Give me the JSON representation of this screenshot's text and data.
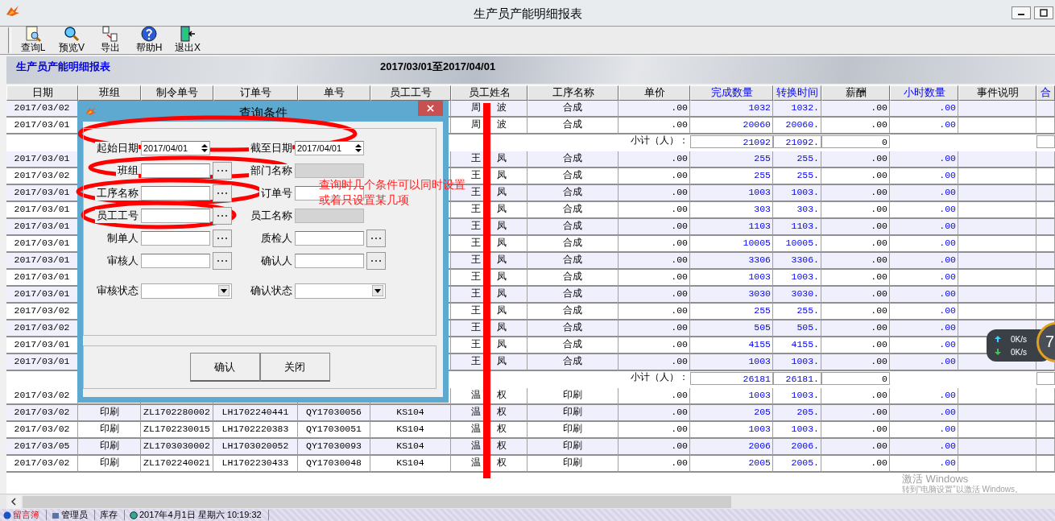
{
  "window": {
    "title": "生产员产能明细报表"
  },
  "toolbar": [
    {
      "label": "查询L",
      "kind": "query"
    },
    {
      "label": "预览V",
      "kind": "preview"
    },
    {
      "label": "导出",
      "kind": "export"
    },
    {
      "label": "帮助H",
      "kind": "help"
    },
    {
      "label": "退出X",
      "kind": "exit"
    }
  ],
  "report_header": {
    "title": "生产员产能明细报表",
    "date_range": "2017/03/01至2017/04/01"
  },
  "table": {
    "columns": [
      "日期",
      "班组",
      "制令单号",
      "订单号",
      "单号",
      "员工工号",
      "员工姓名",
      "工序名称",
      "单价",
      "完成数量",
      "转换时间",
      "薪酬",
      "小时数量",
      "事件说明",
      "合"
    ],
    "rows": [
      {
        "kind": "data",
        "date": "2017/03/02",
        "employee_name": "周 波",
        "process": "合成",
        "unit_price": ".00",
        "completed_qty": "1032",
        "converted_time": "1032.",
        "pay": ".00",
        "hours": ".00"
      },
      {
        "kind": "data",
        "date": "2017/03/01",
        "employee_name": "周 波",
        "process": "合成",
        "unit_price": ".00",
        "completed_qty": "20060",
        "converted_time": "20060.",
        "pay": ".00",
        "hours": ".00"
      },
      {
        "kind": "subtotal",
        "unit_price": "小计（人）：",
        "completed_qty": "21092",
        "converted_time": "21092.",
        "pay": "0"
      },
      {
        "kind": "data",
        "date": "2017/03/01",
        "employee_name": "王 凤",
        "process": "合成",
        "unit_price": ".00",
        "completed_qty": "255",
        "converted_time": "255.",
        "pay": ".00",
        "hours": ".00"
      },
      {
        "kind": "data",
        "date": "2017/03/02",
        "employee_name": "王 凤",
        "process": "合成",
        "unit_price": ".00",
        "completed_qty": "255",
        "converted_time": "255.",
        "pay": ".00",
        "hours": ".00"
      },
      {
        "kind": "data",
        "date": "2017/03/01",
        "employee_name": "王 凤",
        "process": "合成",
        "unit_price": ".00",
        "completed_qty": "1003",
        "converted_time": "1003.",
        "pay": ".00",
        "hours": ".00"
      },
      {
        "kind": "data",
        "date": "2017/03/01",
        "employee_name": "王 凤",
        "process": "合成",
        "unit_price": ".00",
        "completed_qty": "303",
        "converted_time": "303.",
        "pay": ".00",
        "hours": ".00"
      },
      {
        "kind": "data",
        "date": "2017/03/01",
        "employee_name": "王 凤",
        "process": "合成",
        "unit_price": ".00",
        "completed_qty": "1103",
        "converted_time": "1103.",
        "pay": ".00",
        "hours": ".00"
      },
      {
        "kind": "data",
        "date": "2017/03/01",
        "employee_name": "王 凤",
        "process": "合成",
        "unit_price": ".00",
        "completed_qty": "10005",
        "converted_time": "10005.",
        "pay": ".00",
        "hours": ".00"
      },
      {
        "kind": "data",
        "date": "2017/03/01",
        "employee_name": "王 凤",
        "process": "合成",
        "unit_price": ".00",
        "completed_qty": "3306",
        "converted_time": "3306.",
        "pay": ".00",
        "hours": ".00"
      },
      {
        "kind": "data",
        "date": "2017/03/01",
        "employee_name": "王 凤",
        "process": "合成",
        "unit_price": ".00",
        "completed_qty": "1003",
        "converted_time": "1003.",
        "pay": ".00",
        "hours": ".00"
      },
      {
        "kind": "data",
        "date": "2017/03/01",
        "employee_name": "王 凤",
        "process": "合成",
        "unit_price": ".00",
        "completed_qty": "3030",
        "converted_time": "3030.",
        "pay": ".00",
        "hours": ".00"
      },
      {
        "kind": "data",
        "date": "2017/03/02",
        "employee_name": "王 凤",
        "process": "合成",
        "unit_price": ".00",
        "completed_qty": "255",
        "converted_time": "255.",
        "pay": ".00",
        "hours": ".00"
      },
      {
        "kind": "data",
        "date": "2017/03/02",
        "employee_name": "王 凤",
        "process": "合成",
        "unit_price": ".00",
        "completed_qty": "505",
        "converted_time": "505.",
        "pay": ".00",
        "hours": ".00"
      },
      {
        "kind": "data",
        "date": "2017/03/01",
        "employee_name": "王 凤",
        "process": "合成",
        "unit_price": ".00",
        "completed_qty": "4155",
        "converted_time": "4155.",
        "pay": ".00",
        "hours": ".00"
      },
      {
        "kind": "data",
        "date": "2017/03/01",
        "employee_name": "王 凤",
        "process": "合成",
        "unit_price": ".00",
        "completed_qty": "1003",
        "converted_time": "1003.",
        "pay": ".00",
        "hours": ".00"
      },
      {
        "kind": "subtotal",
        "unit_price": "小计（人）：",
        "completed_qty": "26181",
        "converted_time": "26181.",
        "pay": "0"
      },
      {
        "kind": "data",
        "date": "2017/03/02",
        "employee_name": "温 权",
        "process": "印刷",
        "unit_price": ".00",
        "completed_qty": "1003",
        "converted_time": "1003.",
        "pay": ".00",
        "hours": ".00"
      },
      {
        "kind": "data",
        "date": "2017/03/02",
        "team": "印刷",
        "work_order": "ZL1702280002",
        "order_no": "LH1702240441",
        "doc_no": "QY17030056",
        "employee_id": "KS104",
        "employee_name": "温 权",
        "process": "印刷",
        "unit_price": ".00",
        "completed_qty": "205",
        "converted_time": "205.",
        "pay": ".00",
        "hours": ".00"
      },
      {
        "kind": "data",
        "date": "2017/03/02",
        "team": "印刷",
        "work_order": "ZL1702230015",
        "order_no": "LH1702220383",
        "doc_no": "QY17030051",
        "employee_id": "KS104",
        "employee_name": "温 权",
        "process": "印刷",
        "unit_price": ".00",
        "completed_qty": "1003",
        "converted_time": "1003.",
        "pay": ".00",
        "hours": ".00"
      },
      {
        "kind": "data",
        "date": "2017/03/05",
        "team": "印刷",
        "work_order": "ZL1703030002",
        "order_no": "LH1703020052",
        "doc_no": "QY17030093",
        "employee_id": "KS104",
        "employee_name": "温 权",
        "process": "印刷",
        "unit_price": ".00",
        "completed_qty": "2006",
        "converted_time": "2006.",
        "pay": ".00",
        "hours": ".00"
      },
      {
        "kind": "data",
        "date": "2017/03/02",
        "team": "印刷",
        "work_order": "ZL1702240021",
        "order_no": "LH1702230433",
        "doc_no": "QY17030048",
        "employee_id": "KS104",
        "employee_name": "温 权",
        "process": "印刷",
        "unit_price": ".00",
        "completed_qty": "2005",
        "converted_time": "2005.",
        "pay": ".00",
        "hours": ".00"
      }
    ]
  },
  "query_dialog": {
    "title": "查询条件",
    "fields": [
      {
        "label": "起始日期",
        "kind": "date",
        "value": "2017/04/01",
        "disabled": false
      },
      {
        "label": "截至日期",
        "kind": "date",
        "value": "2017/04/01",
        "disabled": false
      },
      {
        "label": "班组",
        "kind": "lookup",
        "disabled": false
      },
      {
        "label": "部门名称",
        "kind": "text",
        "disabled": true
      },
      {
        "label": "工序名称",
        "kind": "lookup",
        "disabled": false
      },
      {
        "label": "订单号",
        "kind": "text",
        "disabled": false
      },
      {
        "label": "员工工号",
        "kind": "lookup",
        "disabled": false
      },
      {
        "label": "员工名称",
        "kind": "text",
        "disabled": true
      },
      {
        "label": "制单人",
        "kind": "lookup",
        "disabled": false
      },
      {
        "label": "质检人",
        "kind": "lookup",
        "disabled": false
      },
      {
        "label": "审核人",
        "kind": "lookup",
        "disabled": false
      },
      {
        "label": "确认人",
        "kind": "lookup",
        "disabled": false
      },
      {
        "label": "审核状态",
        "kind": "select",
        "disabled": false
      },
      {
        "label": "确认状态",
        "kind": "select",
        "disabled": false
      }
    ],
    "buttons": [
      "确认",
      "关闭"
    ]
  },
  "annotation": {
    "lines": [
      "查询时几个条件可以同时设置",
      "或着只设置某几项"
    ]
  },
  "taskbar": {
    "items": [
      {
        "label": "留言簿",
        "kind": "guestbook"
      },
      {
        "label": "管理员",
        "kind": "user"
      },
      {
        "label": "库存",
        "kind": "plain"
      },
      {
        "label": "2017年4月1日  星期六  10:19:32",
        "kind": "clock"
      }
    ]
  },
  "os_overlay": {
    "activation": [
      "激活 Windows",
      "转到“电脑设置”以激活 Windows。"
    ],
    "upload": "0K/s",
    "download": "0K/s",
    "gauge": "7"
  }
}
